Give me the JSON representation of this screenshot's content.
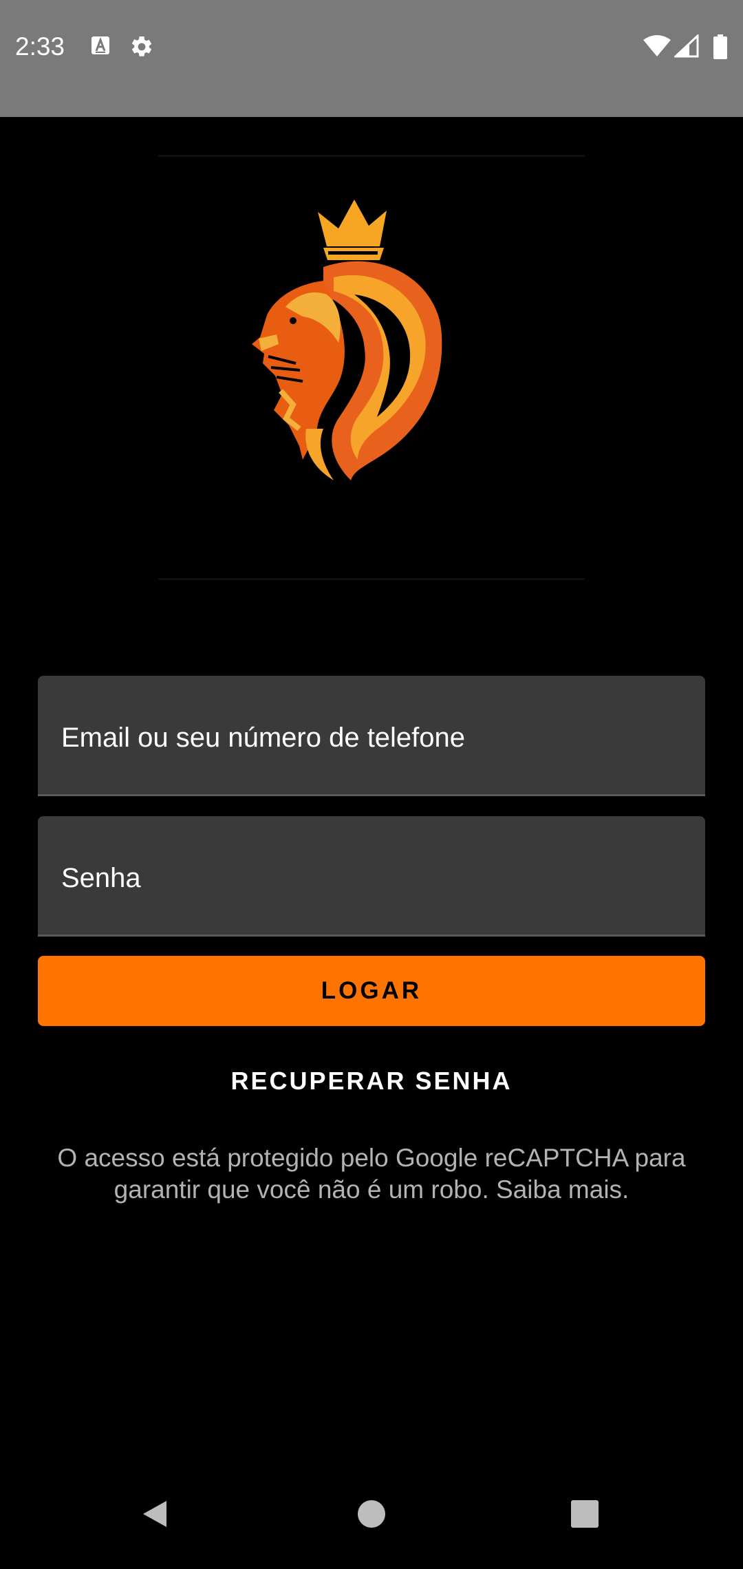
{
  "status_bar": {
    "time": "2:33",
    "left_icons": [
      "text-a-icon",
      "gear-icon"
    ],
    "right_icons": [
      "wifi-icon",
      "signal-icon",
      "battery-icon"
    ],
    "background_color": "#7a7a7a"
  },
  "login": {
    "logo_name": "crowned-lion-logo",
    "email_placeholder": "Email ou seu número de telefone",
    "password_placeholder": "Senha",
    "login_label": "LOGAR",
    "recover_label": "RECUPERAR SENHA",
    "recaptcha_text": "O acesso está protegido pelo Google reCAPTCHA para garantir que você não é um robo. Saiba mais."
  },
  "colors": {
    "background": "#000000",
    "accent": "#ff7300",
    "field_background": "#3a3a3a",
    "note_text": "#b3b3b3"
  },
  "nav_bar": {
    "buttons": [
      "back-icon",
      "home-icon",
      "recents-icon"
    ]
  }
}
